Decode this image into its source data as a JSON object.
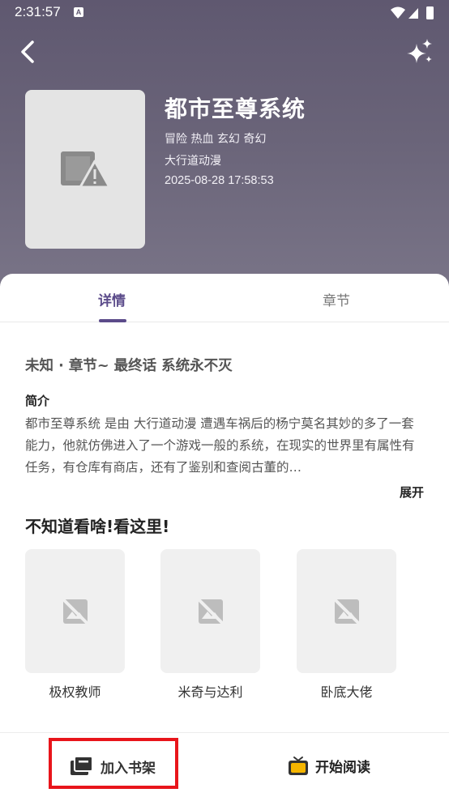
{
  "status_bar": {
    "time": "2:31:57",
    "notif_glyph": "A"
  },
  "header": {
    "back_icon": "back-arrow-icon",
    "action_icon": "sparkle-icon"
  },
  "book": {
    "title": "都市至尊系统",
    "tags": "冒险 热血 玄幻 奇幻",
    "author": "大行道动漫",
    "updated": "2025-08-28 17:58:53",
    "cover_icon": "broken-image-icon"
  },
  "tabs": [
    {
      "label": "详情",
      "active": true
    },
    {
      "label": "章节",
      "active": false
    }
  ],
  "detail": {
    "progress": "未知 · 章节~ 最终话 系统永不灭",
    "intro_label": "简介",
    "intro_text": "都市至尊系统 是由 大行道动漫 遭遇车祸后的杨宁莫名其妙的多了一套能力，他就仿佛进入了一个游戏一般的系统，在现实的世界里有属性有任务，有仓库有商店，还有了鉴别和查阅古董的…",
    "expand_label": "展开"
  },
  "recommend": {
    "title": "不知道看啥!看这里!",
    "items": [
      {
        "name": "极权教师"
      },
      {
        "name": "米奇与达利"
      },
      {
        "name": "卧底大佬"
      }
    ]
  },
  "bottom_bar": {
    "shelf_label": "加入书架",
    "read_label": "开始阅读",
    "accent": "#f5b500",
    "highlight_color": "#e8151b"
  },
  "colors": {
    "hero_bg": "#655f74",
    "tab_active": "#5b4b8a"
  }
}
